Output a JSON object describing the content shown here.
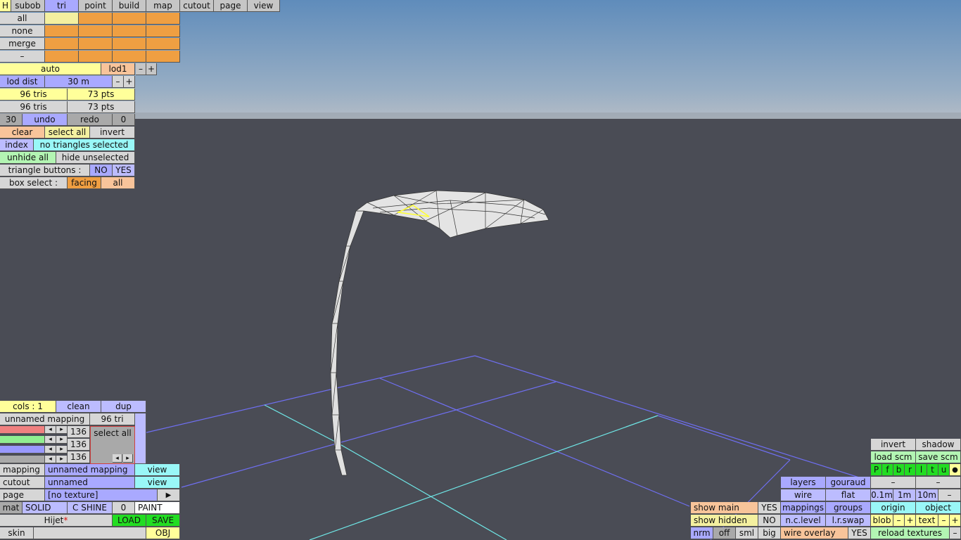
{
  "toolbar": {
    "h": "H",
    "tabs": [
      "subob",
      "tri",
      "point",
      "build",
      "map",
      "cutout",
      "page",
      "view"
    ]
  },
  "subob": {
    "rows": [
      "all",
      "none",
      "merge",
      "–"
    ],
    "lod": {
      "auto": "auto",
      "lod1": "lod1",
      "minus": "–",
      "plus": "+"
    },
    "lod_dist": {
      "label": "lod dist",
      "value": "30 m",
      "minus": "–",
      "plus": "+"
    },
    "stats1": {
      "tris": "96 tris",
      "pts": "73 pts"
    },
    "stats2": {
      "tris": "96 tris",
      "pts": "73 pts"
    },
    "undo_row": {
      "count": "30",
      "undo": "undo",
      "redo": "redo",
      "redo_count": "0"
    },
    "select_row": {
      "clear": "clear",
      "select_all": "select all",
      "invert": "invert"
    },
    "index_row": {
      "index": "index",
      "status": "no triangles selected"
    },
    "hide_row": {
      "unhide_all": "unhide all",
      "hide_unselected": "hide unselected"
    },
    "tri_buttons": {
      "label": "triangle buttons :",
      "no": "NO",
      "yes": "YES"
    },
    "box_select": {
      "label": "box select :",
      "facing": "facing",
      "all": "all"
    }
  },
  "bottom_left": {
    "cols": "cols : 1",
    "clean": "clean",
    "dup": "dup",
    "mapping_name": "unnamed mapping",
    "tri_count": "96 tri",
    "sliders": [
      {
        "value": "136",
        "color": "#f08080"
      },
      {
        "value": "136",
        "color": "#90ee90"
      },
      {
        "value": "136",
        "color": "#9999ff"
      }
    ],
    "arrow_left": "◂",
    "arrow_right": "▸",
    "select_all": "select all",
    "mapping_row": {
      "label": "mapping",
      "value": "unnamed mapping",
      "view": "view"
    },
    "cutout_row": {
      "label": "cutout",
      "value": "unnamed",
      "view": "view"
    },
    "page_row": {
      "label": "page",
      "value": "[no texture]",
      "arrow": "▶"
    },
    "mat_row": {
      "mat": "mat",
      "solid": "SOLID",
      "c_shine": "C SHINE",
      "zero": "0",
      "paint": "PAINT"
    },
    "file_row": {
      "name": "Hijet",
      "mark": "*",
      "load": "LOAD",
      "save": "SAVE"
    },
    "skin_row": {
      "skin": "skin",
      "obj": "OBJ"
    }
  },
  "bottom_right": {
    "invert": "invert",
    "shadow": "shadow",
    "load_scm": "load scm",
    "save_scm": "save scm",
    "view_letters": [
      "P",
      "f",
      "b",
      "r",
      "l",
      "t",
      "u",
      "●"
    ],
    "layers": "layers",
    "gouraud": "gouraud",
    "minus": "–",
    "wire": "wire",
    "flat": "flat",
    "grid_sizes": [
      "0.1m",
      "1m",
      "10m"
    ],
    "show_main": "show main",
    "show_main_val": "YES",
    "mappings": "mappings",
    "groups": "groups",
    "origin": "origin",
    "object": "object",
    "show_hidden": "show hidden",
    "show_hidden_val": "NO",
    "nc_level": "n.c.level",
    "lr_swap": "l.r.swap",
    "blob": "blob",
    "text": "text",
    "plus": "+",
    "nrm": "nrm",
    "off": "off",
    "sml": "sml",
    "big": "big",
    "wire_overlay": "wire overlay",
    "wire_overlay_val": "YES",
    "reload_textures": "reload textures"
  },
  "colors": {
    "sky_top": "#6a8fb8",
    "sky_bottom": "#a8b6c6",
    "ground": "#4a4c55",
    "grid_blue": "#6f6ff2",
    "grid_cyan": "#6fe6e6",
    "mesh": "#e4e4e4",
    "selection": "#ffff33"
  }
}
